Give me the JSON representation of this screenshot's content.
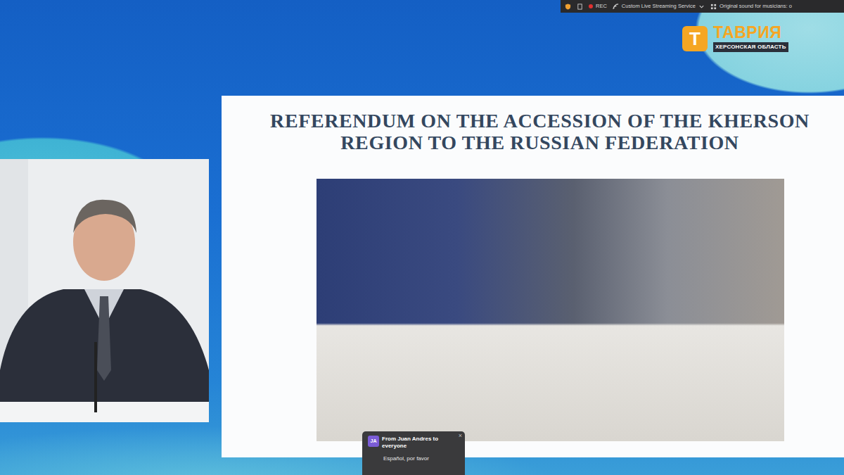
{
  "toolbar": {
    "rec": "REC",
    "stream": "Custom Live Streaming Service",
    "sound": "Original sound for musicians: o"
  },
  "logo": {
    "letter": "Т",
    "name": "ТАВРИЯ",
    "region": "ХЕРСОНСКАЯ ОБЛАСТЬ"
  },
  "slide": {
    "title": "REFERENDUM ON THE ACCESSION OF THE KHERSON REGION TO THE RUSSIAN FEDERATION"
  },
  "chat": {
    "avatar": "JA",
    "sender": "From Juan Andres to everyone",
    "message": "Español, por favor",
    "close": "×"
  }
}
